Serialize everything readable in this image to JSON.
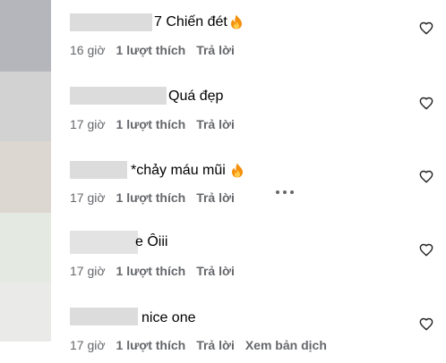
{
  "comments": [
    {
      "text_prefix": "7",
      "text": "Chiến đét",
      "time": "16 giờ",
      "likes": "1 lượt thích",
      "reply": "Trả lời"
    },
    {
      "text_prefix": "",
      "text": "Quá đẹp",
      "time": "17 giờ",
      "likes": "1 lượt thích",
      "reply": "Trả lời"
    },
    {
      "text_prefix": "",
      "text": "*chảy máu mũi",
      "time": "17 giờ",
      "likes": "1 lượt thích",
      "reply": "Trả lời"
    },
    {
      "text_prefix": "",
      "text": "e Ôiii",
      "time": "17 giờ",
      "likes": "1 lượt thích",
      "reply": "Trả lời"
    },
    {
      "text_prefix": "",
      "text": "nice one",
      "time": "17 giờ",
      "likes": "1 lượt thích",
      "reply": "Trả lời",
      "translate": "Xem bản dịch"
    }
  ],
  "icons": {
    "like": "heart-outline-icon",
    "reaction": "fire-emoji-icon",
    "more": "more-options-icon"
  },
  "colors": {
    "meta_text": "#65676b",
    "redaction": "#dcdcdc",
    "fire_outer": "#f4900c",
    "fire_inner": "#ffcc4d"
  }
}
